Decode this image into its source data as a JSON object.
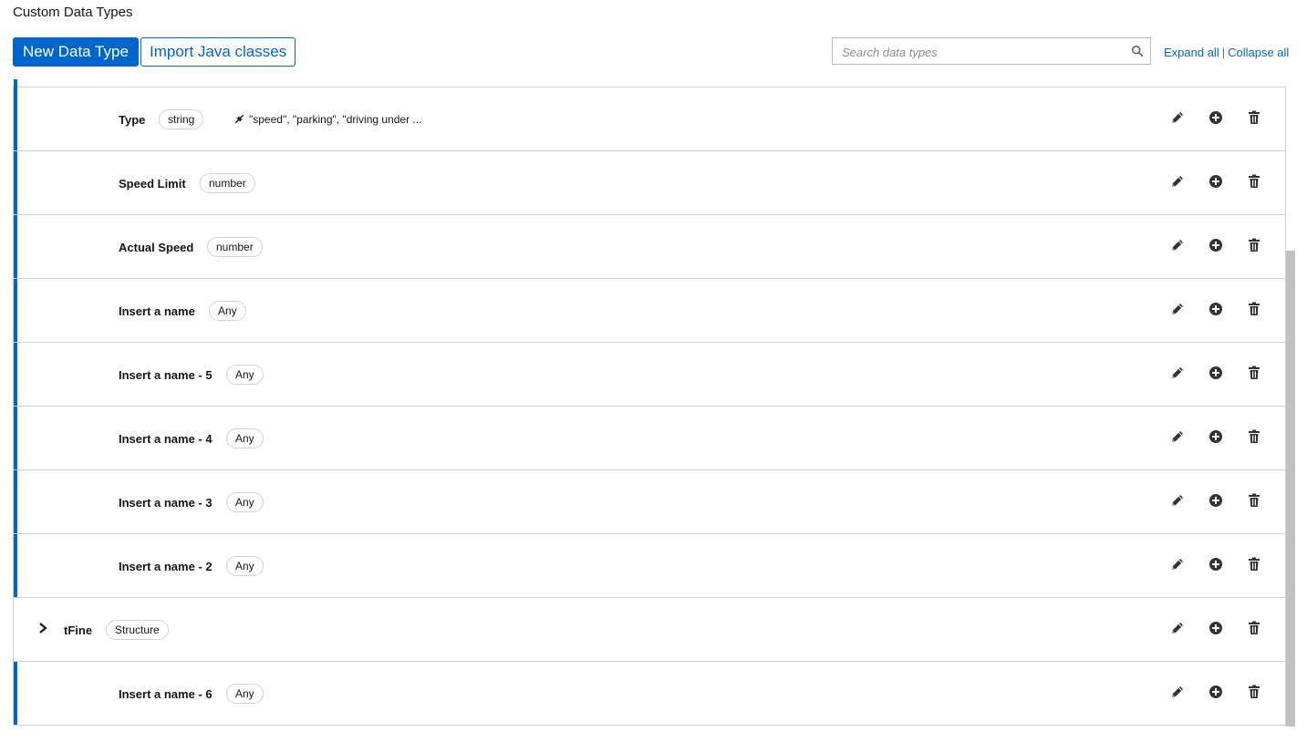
{
  "header": {
    "title": "Custom Data Types",
    "new_button": "New Data Type",
    "import_button": "Import Java classes",
    "search_placeholder": "Search data types",
    "expand_all": "Expand all",
    "separator": "|",
    "collapse_all": "Collapse all"
  },
  "rows": [
    {
      "name": "Type",
      "type": "string",
      "constraint": "\"speed\", \"parking\", \"driving under ...",
      "kind": "child"
    },
    {
      "name": "Speed Limit",
      "type": "number",
      "kind": "child"
    },
    {
      "name": "Actual Speed",
      "type": "number",
      "kind": "child"
    },
    {
      "name": "Insert a name",
      "type": "Any",
      "kind": "child"
    },
    {
      "name": "Insert a name - 5",
      "type": "Any",
      "kind": "child"
    },
    {
      "name": "Insert a name - 4",
      "type": "Any",
      "kind": "child"
    },
    {
      "name": "Insert a name - 3",
      "type": "Any",
      "kind": "child"
    },
    {
      "name": "Insert a name - 2",
      "type": "Any",
      "kind": "child"
    },
    {
      "name": "tFine",
      "type": "Structure",
      "kind": "parent",
      "expanded": false
    },
    {
      "name": "Insert a name - 6",
      "type": "Any",
      "kind": "child"
    }
  ],
  "icons": {
    "search": "search-icon",
    "edit": "pencil-icon",
    "add": "plus-circle-icon",
    "delete": "trash-icon",
    "constraint": "constraint-icon",
    "expand": "chevron-right-icon"
  },
  "colors": {
    "accent": "#0066cc",
    "border": "#d2d2d2",
    "text": "#151515",
    "icon": "#333333"
  }
}
